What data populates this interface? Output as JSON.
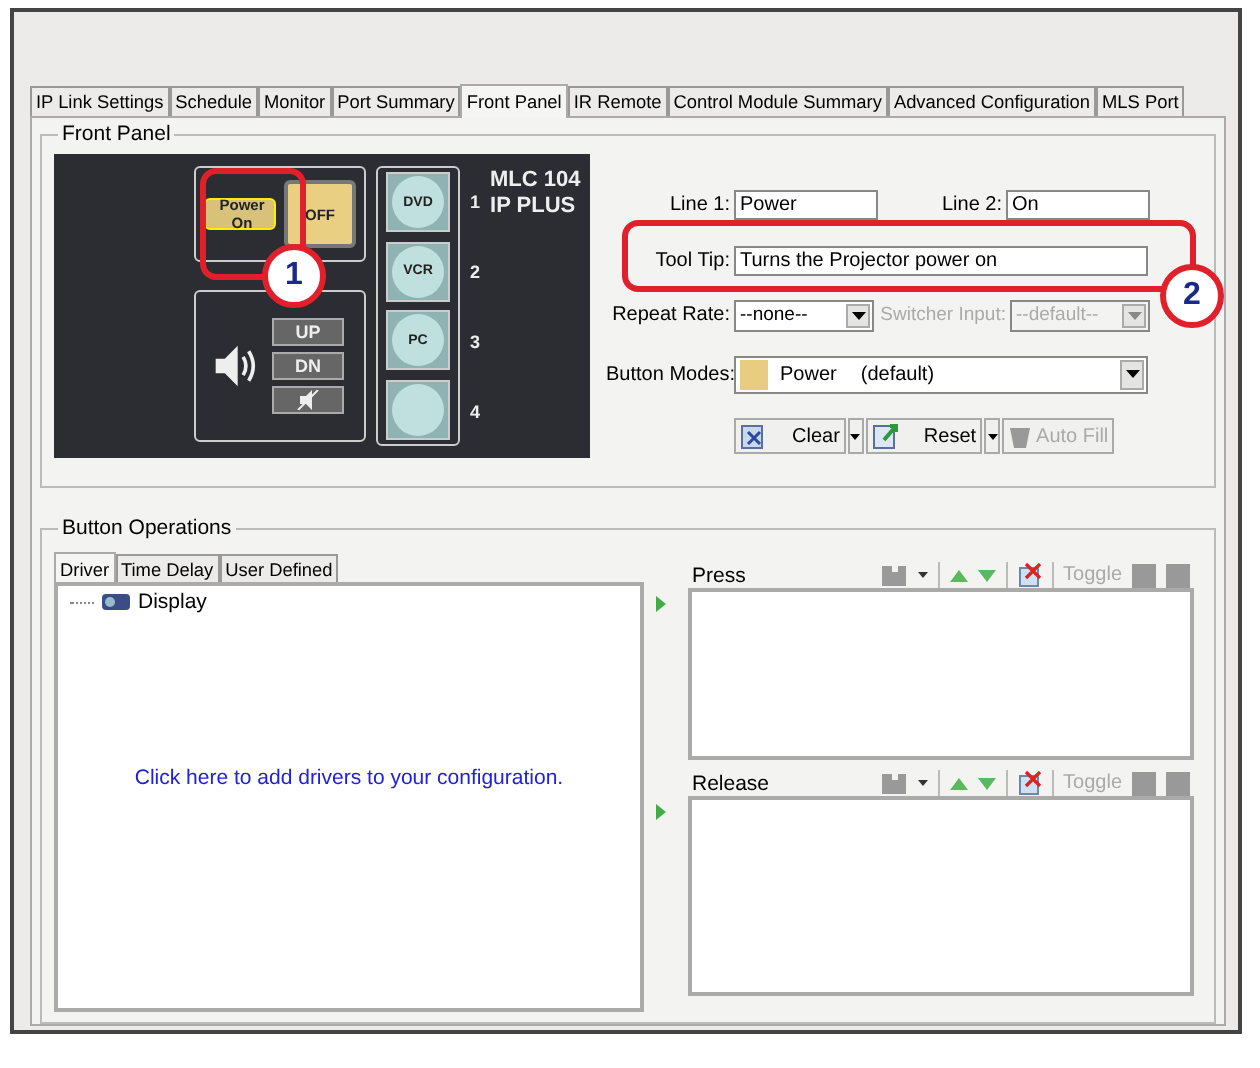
{
  "tabs": [
    {
      "label": "IP Link Settings",
      "selected": false
    },
    {
      "label": "Schedule",
      "selected": false
    },
    {
      "label": "Monitor",
      "selected": false
    },
    {
      "label": "Port Summary",
      "selected": false
    },
    {
      "label": "Front Panel",
      "selected": true
    },
    {
      "label": "IR Remote",
      "selected": false
    },
    {
      "label": "Control Module Summary",
      "selected": false
    },
    {
      "label": "Advanced Configuration",
      "selected": false
    },
    {
      "label": "MLS Port",
      "selected": false
    }
  ],
  "front_panel": {
    "title": "Front Panel",
    "device": {
      "model": "MLC 104",
      "model_line2": "IP PLUS",
      "display_buttons": [
        {
          "line1": "Power",
          "line2": "On",
          "selected": true
        },
        {
          "line1": "OFF",
          "selected": false
        }
      ],
      "volume_buttons": [
        {
          "kind": "up",
          "label": "UP"
        },
        {
          "kind": "down",
          "label": "DN"
        },
        {
          "kind": "mute"
        }
      ],
      "input_buttons": [
        {
          "label": "DVD",
          "number": "1"
        },
        {
          "label": "VCR",
          "number": "2"
        },
        {
          "label": "PC",
          "number": "3"
        },
        {
          "number": "4"
        }
      ]
    },
    "callouts": [
      "1",
      "2"
    ],
    "line1": {
      "label": "Line 1:",
      "value": "Power"
    },
    "line2": {
      "label": "Line 2:",
      "value": "On"
    },
    "tooltip": {
      "label": "Tool Tip:",
      "value": "Turns the Projector power on"
    },
    "repeat_rate": {
      "label": "Repeat Rate:",
      "value": "--none--",
      "disabled": false
    },
    "switcher_input": {
      "label": "Switcher Input:",
      "value": "--default--",
      "disabled": true
    },
    "button_modes": {
      "label": "Button Modes:",
      "value": "Power",
      "note": "(default)",
      "color": "#e8cc80"
    },
    "actions": [
      {
        "label": "Clear",
        "kind": "clear",
        "disabled": false
      },
      {
        "label": "Reset",
        "kind": "reset",
        "disabled": false
      },
      {
        "label": "Auto Fill",
        "kind": "autofill",
        "disabled": true
      }
    ]
  },
  "button_operations": {
    "title": "Button Operations",
    "tabs": [
      {
        "label": "Driver",
        "selected": true
      },
      {
        "label": "Time Delay",
        "selected": false
      },
      {
        "label": "User Defined",
        "selected": false
      }
    ],
    "tree": [
      {
        "label": "Display"
      }
    ],
    "link": "Click here to add drivers to your configuration.",
    "panels": [
      {
        "label": "Press",
        "toggle": "Toggle",
        "toggle_disabled": true
      },
      {
        "label": "Release",
        "toggle": "Toggle",
        "toggle_disabled": true
      }
    ]
  }
}
